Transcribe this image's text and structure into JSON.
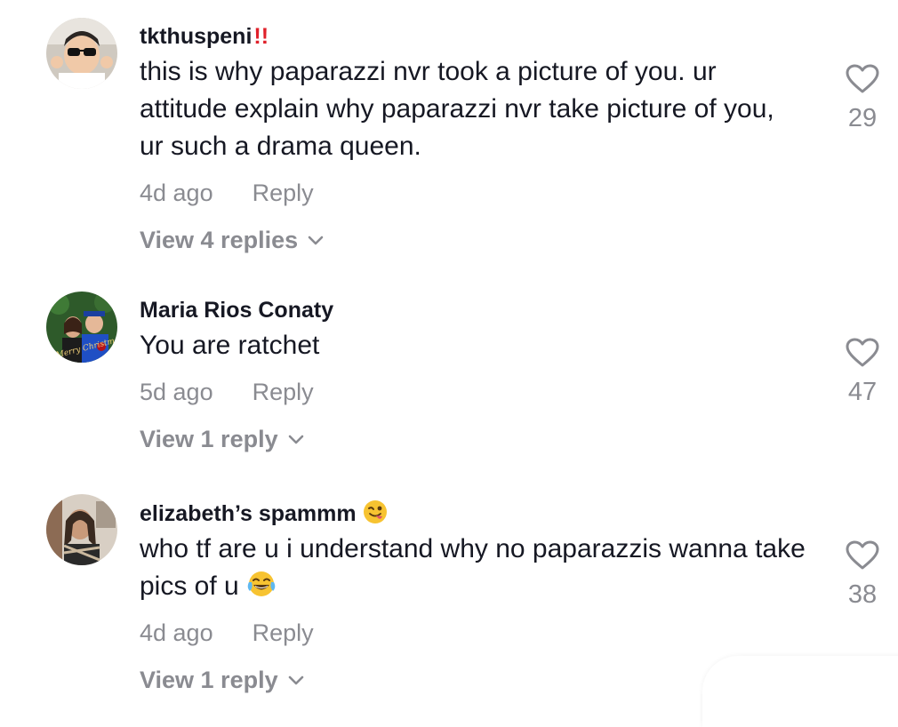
{
  "comments": [
    {
      "username": "tkthuspeni",
      "username_suffix": "!!",
      "text": "this is why paparazzi nvr took a picture of you. ur attitude explain why paparazzi nvr take picture of you, ur such a drama queen.",
      "time": "4d ago",
      "reply_label": "Reply",
      "view_replies": "View 4 replies",
      "likes": "29"
    },
    {
      "username": "Maria Rios Conaty",
      "text": "You are ratchet",
      "time": "5d ago",
      "reply_label": "Reply",
      "view_replies": "View 1 reply",
      "likes": "47"
    },
    {
      "username": "elizabeth’s spammm",
      "text": "who tf are u i understand why no paparazzis wanna take pics of u",
      "time": "4d ago",
      "reply_label": "Reply",
      "view_replies": "View 1 reply",
      "likes": "38"
    }
  ],
  "avatar_overlay_text": "Merry Christmas",
  "colors": {
    "text": "#161823",
    "secondary": "#8a8b91",
    "exclamation": "#e0202a"
  },
  "icons": {
    "like": "heart-outline-icon",
    "expand": "chevron-down-icon",
    "emoji_wink": "winking-tongue-emoji",
    "emoji_laugh": "tears-of-joy-emoji"
  }
}
